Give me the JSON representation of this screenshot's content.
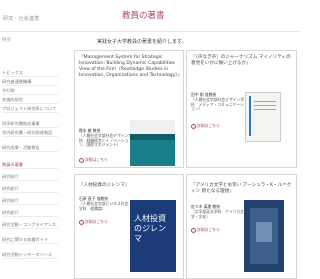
{
  "header": {
    "section_label": "研究・社会連携",
    "page_title": "教員の著書"
  },
  "sidebar": {
    "heading": "研究",
    "items": [
      {
        "label": "トピックス"
      },
      {
        "label": "研究者連携機構"
      },
      {
        "label": "刊行物"
      },
      {
        "label": "先進的研究"
      },
      {
        "label": "プロジェクト研究所について"
      },
      {
        "label": "科学研究費助成事業"
      },
      {
        "label": "学内研究費・研究助成制度"
      },
      {
        "label": "研究成果・活動報告"
      },
      {
        "label": "教員の著書",
        "active": true
      },
      {
        "label": "研究紹介"
      },
      {
        "label": "研究紹介"
      },
      {
        "label": "研究紹介"
      },
      {
        "label": "研究紹介"
      },
      {
        "label": "研究活動・コンプライアンス"
      },
      {
        "label": "研究に関する各種ガイド"
      },
      {
        "label": "研究活動インデータベース"
      }
    ]
  },
  "intro": "実践女子大学教員の著書を紹介します。",
  "books": [
    {
      "title": "『Management System for Strategic Innovation: Building Dynamic Capabilities View of the Firm（Routledge Studies in Innovation, Organizations and Technology）』",
      "author_name": "樫本 敏 教授",
      "author_affiliation": "（人間社会学部社会デザイン学科　経験経営とイノベーション、国際マネジメント）",
      "link": "詳細はこちら"
    },
    {
      "title": "『〈声なき声〉のジャーナリズム マイノリティの意見をいかに掬い上げるか』",
      "author_name": "田中 剛 准教授",
      "author_affiliation": "（人間社会学部社会デザイン学科　メディア・コミュニケーション）",
      "link": "詳細はこちら"
    },
    {
      "title": "『人材投資のジレンマ』",
      "author_name": "石原 直子 准教授",
      "author_affiliation": "（人間社会学部ビジネス社会学科　組織論）",
      "link": "詳細はこちら"
    },
    {
      "title": "『アメリカ文学とお笑い アーシュラ・K・ル＝グィン 新たなる理想』",
      "author_name": "佐々木 真理 教授",
      "author_affiliation": "（文学部英文学科　アメリカ文学・文化）",
      "link": "詳細はこちら"
    }
  ],
  "book_covers": {
    "book3_text": "人材投資のジレンマ"
  }
}
